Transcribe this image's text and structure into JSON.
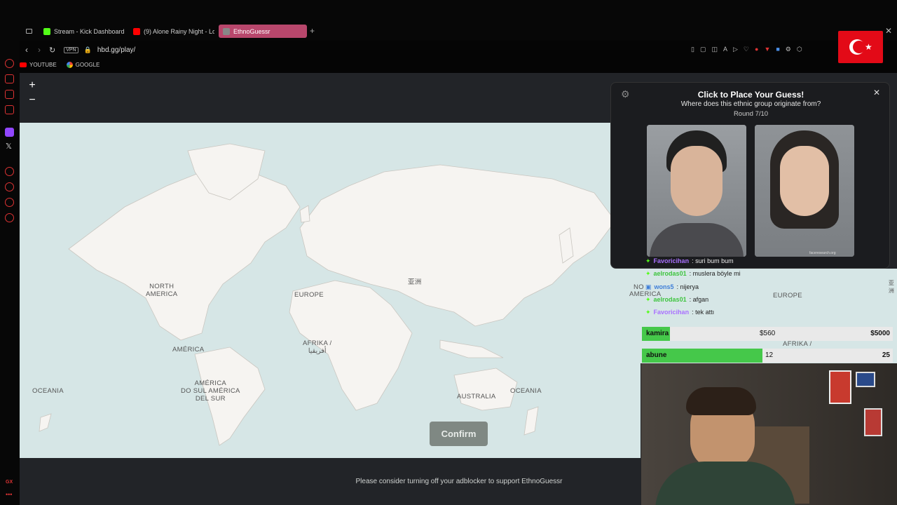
{
  "browser": {
    "tabs": [
      {
        "label": "Stream - Kick Dashboard",
        "color": "#53fc18"
      },
      {
        "label": "(9) Alone Rainy Night - Lo",
        "color": "#ff0000"
      },
      {
        "label": "EthnoGuessr",
        "color": "#888888"
      }
    ],
    "new_tab": "+",
    "vpn": "VPN",
    "url": "hbd.gg/play/",
    "bookmarks": [
      "YOUTUBE",
      "GOOGLE"
    ]
  },
  "map": {
    "zoom_in": "+",
    "zoom_out": "−",
    "labels": {
      "north_america": "NORTH\nAMERICA",
      "europe": "EUROPE",
      "asia": "亚洲",
      "africa": "AFRIKA /\nأفريقيا",
      "america": "AMÉRICA",
      "south_america": "AMÉRICA\nDO SUL AMÉRICA\nDEL SUR",
      "oceania_left": "OCEANIA",
      "australia": "AUSTRALIA",
      "oceania_right": "OCEANIA"
    },
    "confirm": "Confirm"
  },
  "panel": {
    "title": "Click to Place Your Guess!",
    "question": "Where does this ethnic group originate from?",
    "round": "Round 7/10",
    "close": "✕",
    "face_credit": "faceresearch.org"
  },
  "chat": [
    {
      "user": "Favoricihan",
      "msg": ": suri bum bum",
      "user_color": "#a970ff"
    },
    {
      "user": "aelrodas01",
      "msg": ": muslera böyle mi",
      "user_color": "#3ec43e"
    },
    {
      "user": "wons5",
      "msg": ": nijerya",
      "user_color": "#3f7fd8"
    },
    {
      "user": "aelrodas01",
      "msg": ": afgan",
      "user_color": "#3ec43e"
    },
    {
      "user": "Favoricihan",
      "msg": ": tek attı",
      "user_color": "#a970ff"
    }
  ],
  "goals": [
    {
      "label": "kamira",
      "current": "$560",
      "target": "$5000",
      "progress": 0.112
    },
    {
      "label": "abune",
      "current": "12",
      "target": "25",
      "progress": 0.48
    }
  ],
  "behind_labels": {
    "no": "NO",
    "rth_america": "AMERICA",
    "europe": "EUROPE",
    "africa": "AFRIKA /",
    "asia": "亚洲"
  },
  "footer": "Please consider turning off your adblocker to support EthnoGuessr",
  "colors": {
    "accent": "#b8476c",
    "goal": "#45c84a",
    "map_water": "#d6e6e6"
  }
}
